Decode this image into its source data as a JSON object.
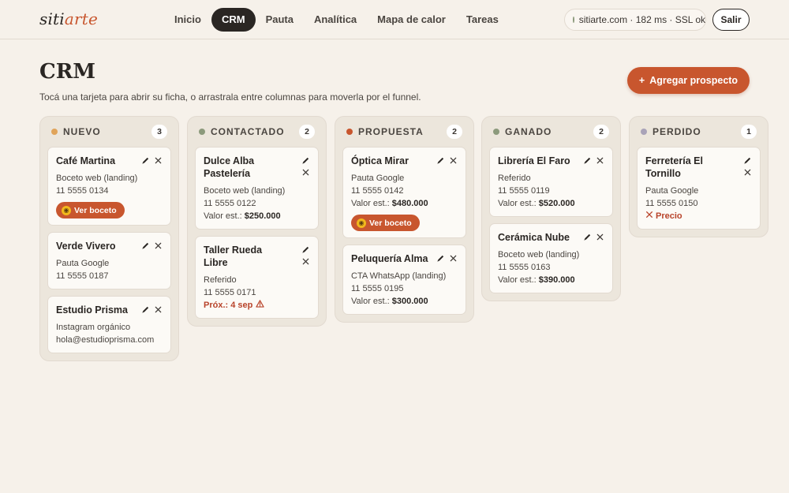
{
  "brand": {
    "part1": "siti",
    "part2": "arte"
  },
  "nav": [
    {
      "label": "Inicio",
      "active": false
    },
    {
      "label": "CRM",
      "active": true
    },
    {
      "label": "Pauta",
      "active": false
    },
    {
      "label": "Analítica",
      "active": false
    },
    {
      "label": "Mapa de calor",
      "active": false
    },
    {
      "label": "Tareas",
      "active": false
    }
  ],
  "status": {
    "text": "sitiarte.com · 182 ms · SSL ok",
    "dot_color": "#8c9a7c"
  },
  "logout_label": "Salir",
  "page": {
    "title": "CRM",
    "subtitle": "Tocá una tarjeta para abrir su ficha, o arrastrala entre columnas para moverla por el funnel.",
    "add_label": "Agregar prospecto",
    "add_plus": "+"
  },
  "columns": [
    {
      "title": "NUEVO",
      "count": "3",
      "color": "#e0a45a",
      "cards": [
        {
          "name": "Café Martina",
          "lines": [
            "Boceto web (landing)",
            "11 5555 0134"
          ],
          "button": "Ver boceto"
        },
        {
          "name": "Verde Vivero",
          "lines": [
            "Pauta Google",
            "11 5555 0187"
          ]
        },
        {
          "name": "Estudio Prisma",
          "lines": [
            "Instagram orgánico",
            "hola@estudioprisma.com"
          ]
        }
      ]
    },
    {
      "title": "CONTACTADO",
      "count": "2",
      "color": "#8c9a7c",
      "cards": [
        {
          "name": "Dulce Alba Pastelería",
          "lines": [
            "Boceto web (landing)",
            "11 5555 0122"
          ],
          "value_label": "Valor est.:",
          "value": "$250.000"
        },
        {
          "name": "Taller Rueda Libre",
          "lines": [
            "Referido",
            "11 5555 0171"
          ],
          "next_date": "Próx.: 4 sep"
        }
      ]
    },
    {
      "title": "PROPUESTA",
      "count": "2",
      "color": "#c8562e",
      "cards": [
        {
          "name": "Óptica Mirar",
          "lines": [
            "Pauta Google",
            "11 5555 0142"
          ],
          "value_label": "Valor est.:",
          "value": "$480.000",
          "button": "Ver boceto"
        },
        {
          "name": "Peluquería Alma",
          "lines": [
            "CTA WhatsApp (landing)",
            "11 5555 0195"
          ],
          "value_label": "Valor est.:",
          "value": "$300.000"
        }
      ]
    },
    {
      "title": "GANADO",
      "count": "2",
      "color": "#8c9a7c",
      "cards": [
        {
          "name": "Librería El Faro",
          "lines": [
            "Referido",
            "11 5555 0119"
          ],
          "value_label": "Valor est.:",
          "value": "$520.000"
        },
        {
          "name": "Cerámica Nube",
          "lines": [
            "Boceto web (landing)",
            "11 5555 0163"
          ],
          "value_label": "Valor est.:",
          "value": "$390.000"
        }
      ]
    },
    {
      "title": "PERDIDO",
      "count": "1",
      "color": "#a9a3b8",
      "cards": [
        {
          "name": "Ferretería El Tornillo",
          "lines": [
            "Pauta Google",
            "11 5555 0150"
          ],
          "lost_reason": "Precio"
        }
      ]
    }
  ]
}
